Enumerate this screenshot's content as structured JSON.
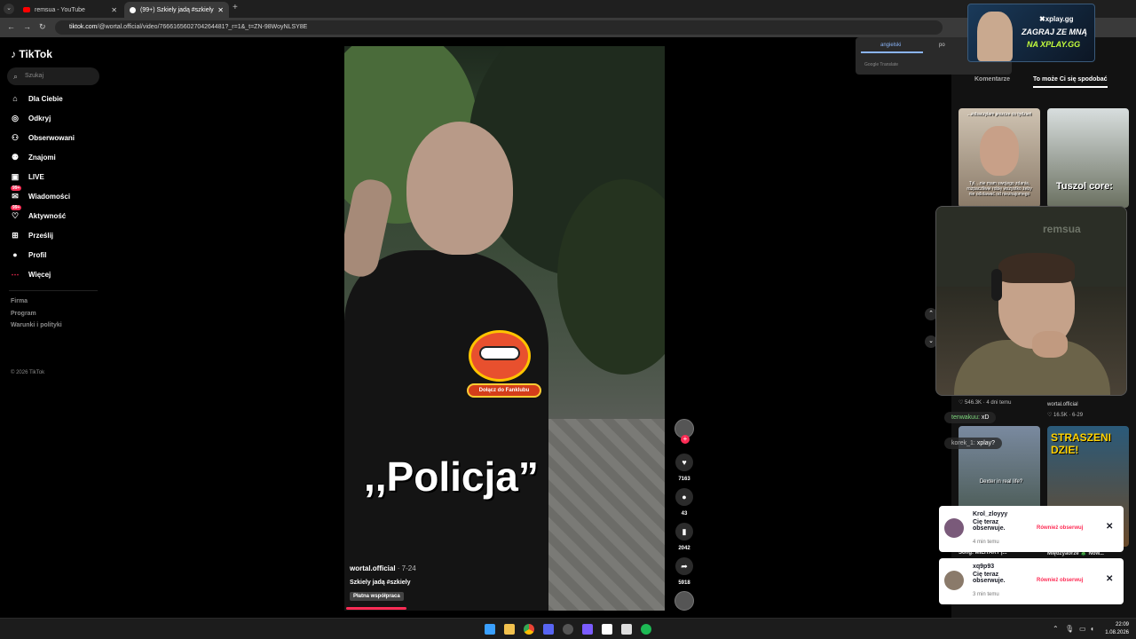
{
  "browser": {
    "tabs": [
      {
        "label": "remsua - YouTube"
      },
      {
        "label": "(99+) Szkiely jadą #szkiely"
      }
    ],
    "url_domain": "tiktok.com",
    "url_rest": "/@wortal.official/video/7666165602704264481?_r=1&_t=ZN-98WoyNLSY8E"
  },
  "sidebar": {
    "logo": "TikTok",
    "search_placeholder": "Szukaj",
    "items": [
      {
        "label": "Dla Ciebie",
        "icon": "home-icon"
      },
      {
        "label": "Odkryj",
        "icon": "compass-icon"
      },
      {
        "label": "Obserwowani",
        "icon": "user-follow-icon"
      },
      {
        "label": "Znajomi",
        "icon": "friends-icon"
      },
      {
        "label": "LIVE",
        "icon": "live-icon"
      },
      {
        "label": "Wiadomości",
        "icon": "message-icon",
        "badge": "99+"
      },
      {
        "label": "Aktywność",
        "icon": "activity-icon",
        "badge": "99+"
      },
      {
        "label": "Prześlij",
        "icon": "upload-icon"
      },
      {
        "label": "Profil",
        "icon": "profile-avatar-icon"
      },
      {
        "label": "Więcej",
        "icon": "more-icon"
      }
    ],
    "footer": [
      "Firma",
      "Program",
      "Warunki i polityki"
    ],
    "copyright": "© 2026 TikTok"
  },
  "video": {
    "overlay_caption": ",,Policja”",
    "fan_button": "Dołącz do Fanklubu",
    "author": "wortal.official",
    "date": "· 7-24",
    "description": "Szkiely jadą #szkiely",
    "paid_label": "Płatna współpraca",
    "progress": 0.19,
    "likes": "7163",
    "comments": "43",
    "saves": "2042",
    "shares": "5918"
  },
  "translate_popup": {
    "lang_active": "angielski",
    "lang_other": "po",
    "product": "Google Translate"
  },
  "ad": {
    "logo": "✖xplay.gg",
    "line1": "ZAGRAJ ZE MNĄ",
    "line2": "NA XPLAY.GG"
  },
  "right_panel": {
    "tab_comments": "Komentarze",
    "tab_suggest": "To może Ci się spodobać",
    "thumb1_top": "...zobaczyłam jeszcze co tydzień",
    "thumb1_bottom": "Tyl. ..nie mam swojego zdania, rozpaczliwie robię wszystko żeby nie odstawać od nieznajomego",
    "thumb2_text": "Tuszol core:",
    "thumb3_text": "Dexter in real life?",
    "thumb4_text": "STRASZENI DZIE!",
    "meta1": "♡ 546.3K · 4 dni temu",
    "meta2_author": "wortal.official",
    "meta2": "♡ 16.5K · 6-29",
    "song": "Song: MILITARY |...",
    "song2": "Międzyaorze 🎄 Now...",
    "cam_brand": "remsua"
  },
  "chat": [
    {
      "user": "tenwakuu:",
      "text": "xD"
    },
    {
      "user": "korek_1:",
      "text": "xplay?"
    }
  ],
  "notifications": [
    {
      "name": "Krol_zloyyy",
      "text": "Cię teraz obserwuje.",
      "time": "4 min temu",
      "follow": "Również obserwuj"
    },
    {
      "name": "xq9p93",
      "text": "Cię teraz obserwuje.",
      "time": "3 min temu",
      "follow": "Również obserwuj"
    }
  ],
  "taskbar": {
    "time": "22:09",
    "date": "1.08.2026"
  }
}
